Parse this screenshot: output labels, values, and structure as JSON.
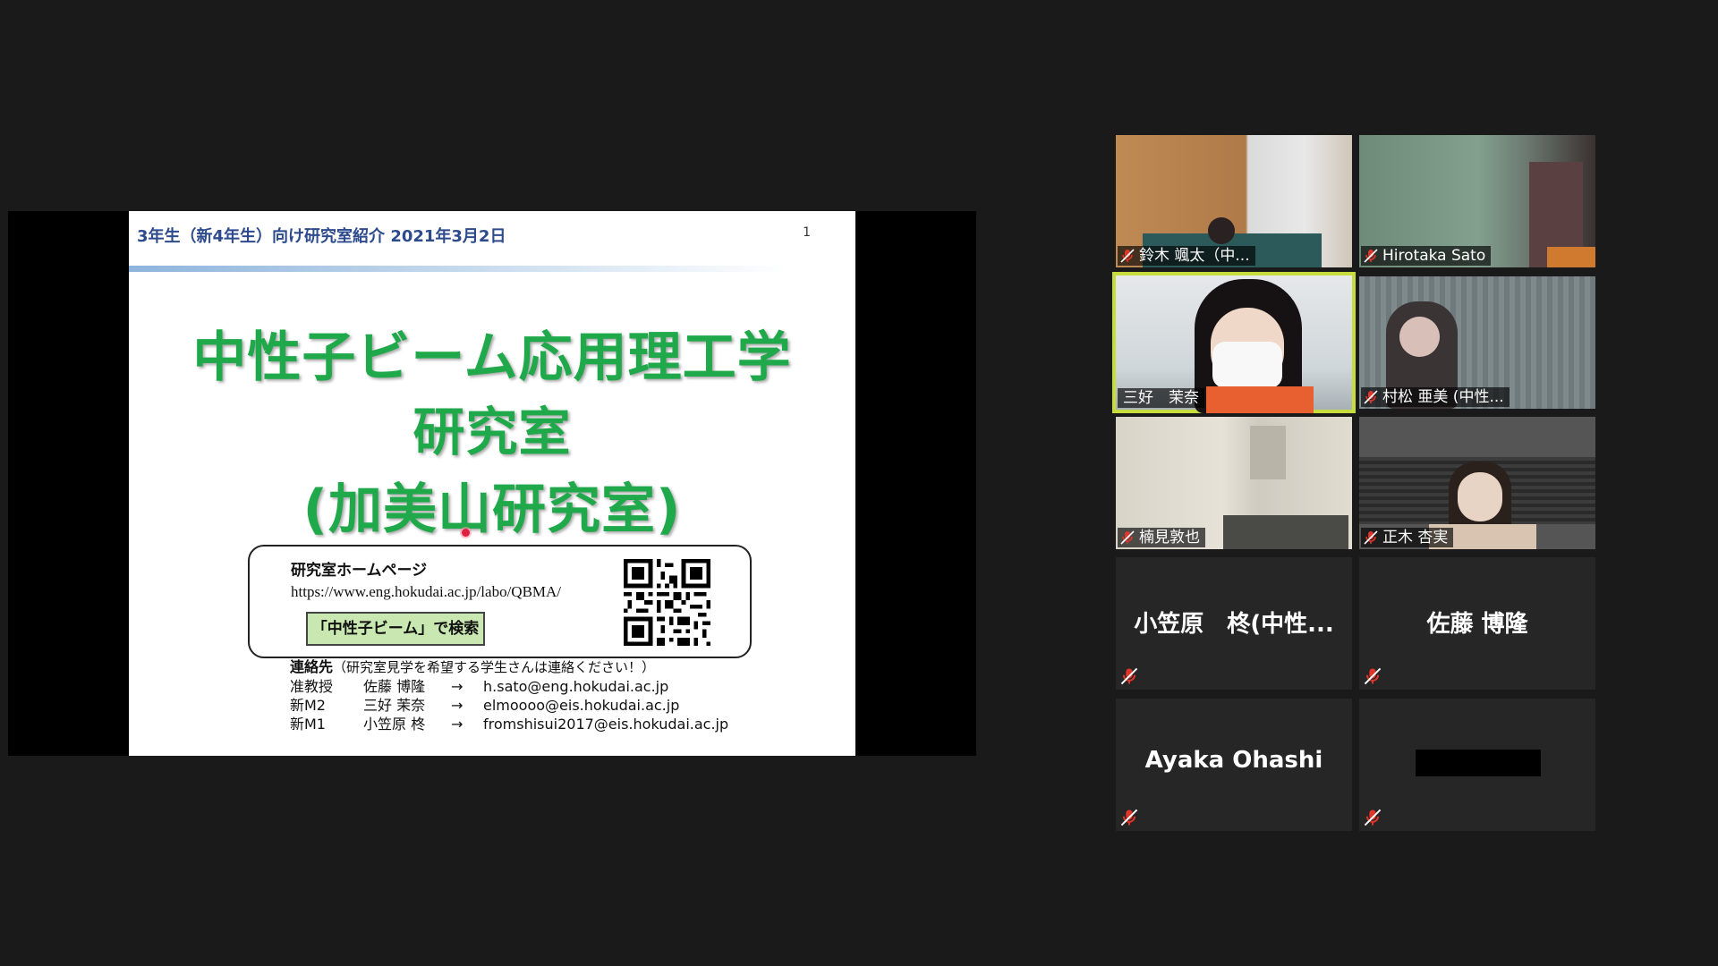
{
  "shared_screen": {
    "slide": {
      "header_title": "3年生（新4年生）向け研究室紹介 2021年3月2日",
      "page_number": "1",
      "title_line1": "中性子ビーム応用理工学",
      "title_line2": "研究室",
      "title_line3": "(加美山研究室)",
      "homepage": {
        "label": "研究室ホームページ",
        "url": "https://www.eng.hokudai.ac.jp/labo/QBMA/",
        "search_hint": "「中性子ビーム」で検索"
      },
      "contact": {
        "heading": "連絡先",
        "note": "（研究室見学を希望する学生さんは連絡ください！）",
        "rows": [
          {
            "role": "准教授",
            "name": "佐藤 博隆",
            "arrow": "→",
            "email": "h.sato@eng.hokudai.ac.jp"
          },
          {
            "role": "新M2",
            "name": "三好 茉奈",
            "arrow": "→",
            "email": "elmoooo@eis.hokudai.ac.jp"
          },
          {
            "role": "新M1",
            "name": "小笠原 柊",
            "arrow": "→",
            "email": "fromshisui2017@eis.hokudai.ac.jp"
          }
        ]
      }
    }
  },
  "participants": [
    {
      "name": "鈴木 颯太（中...",
      "video": true,
      "muted": true,
      "active": false
    },
    {
      "name": "Hirotaka Sato",
      "video": true,
      "muted": true,
      "active": false
    },
    {
      "name": "三好　茉奈",
      "video": true,
      "muted": false,
      "active": true
    },
    {
      "name": "村松 亜美 (中性...",
      "video": true,
      "muted": true,
      "active": false
    },
    {
      "name": "楠見敦也",
      "video": true,
      "muted": true,
      "active": false
    },
    {
      "name": "正木 杏実",
      "video": true,
      "muted": true,
      "active": false
    },
    {
      "name": "小笠原　柊(中性...",
      "video": false,
      "muted": true,
      "active": false
    },
    {
      "name": "佐藤 博隆",
      "video": false,
      "muted": true,
      "active": false
    },
    {
      "name": "Ayaka Ohashi",
      "video": false,
      "muted": true,
      "active": false
    },
    {
      "name": "",
      "video": false,
      "muted": true,
      "active": false,
      "redacted": true
    }
  ],
  "colors": {
    "slide_title_green": "#1fa94a",
    "header_blue": "#2c4a8c",
    "active_speaker_border": "#c6dd3b",
    "mute_red": "#e0352b"
  },
  "icons": [
    "mic-off-icon",
    "pointer-dot-icon",
    "qr-code-icon"
  ]
}
